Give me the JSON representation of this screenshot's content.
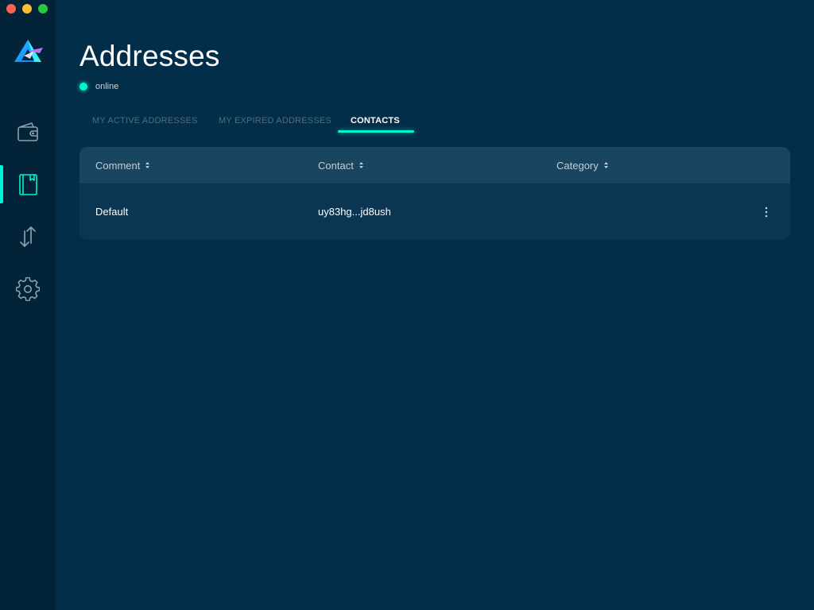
{
  "window": {
    "traffic_lights": [
      "close",
      "minimize",
      "maximize"
    ]
  },
  "sidebar": {
    "logo_icon": "beam-logo-icon",
    "items": [
      {
        "id": "wallet",
        "icon": "wallet-icon",
        "active": false
      },
      {
        "id": "addresses",
        "icon": "address-book-icon",
        "active": true
      },
      {
        "id": "transactions",
        "icon": "transfer-arrows-icon",
        "active": false
      },
      {
        "id": "settings",
        "icon": "gear-icon",
        "active": false
      }
    ]
  },
  "header": {
    "title": "Addresses",
    "status": "online"
  },
  "tabs": [
    {
      "label": "MY ACTIVE ADDRESSES",
      "active": false
    },
    {
      "label": "MY EXPIRED ADDRESSES",
      "active": false
    },
    {
      "label": "CONTACTS",
      "active": true
    }
  ],
  "table": {
    "columns": [
      "Comment",
      "Contact",
      "Category"
    ],
    "rows": [
      {
        "comment": "Default",
        "contact": "uy83hg...jd8ush",
        "category": "",
        "menu_icon": "more-vertical-icon"
      }
    ]
  },
  "colors": {
    "background": "#032e49",
    "sidebar": "#022338",
    "accent": "#00f6d2",
    "table_header": "#1a4561",
    "table_body": "#0a3553"
  }
}
